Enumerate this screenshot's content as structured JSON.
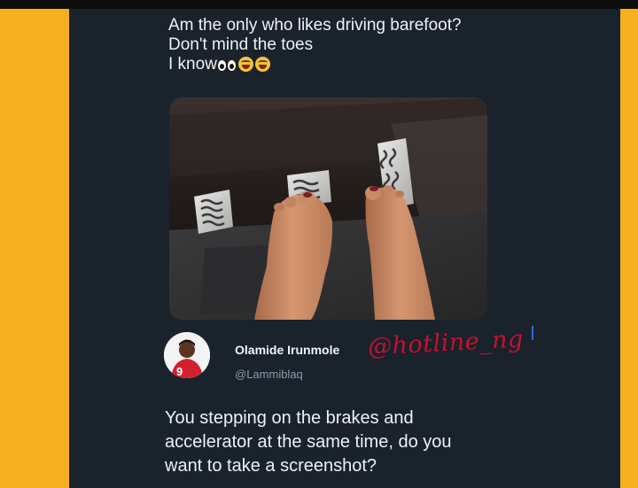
{
  "original_tweet": {
    "lines": [
      "Am the only who likes driving barefoot?",
      "Don't mind the toes",
      "I know"
    ],
    "emojis": [
      "eyes-icon",
      "laughing-face-icon",
      "laughing-face-icon"
    ]
  },
  "photo": {
    "subject": "bare feet on car pedals",
    "image_name": "feet-on-pedals-photo"
  },
  "reply": {
    "display_name": "Olamide Irunmole",
    "handle": "@Lammiblaq",
    "avatar_jersey_number": "9",
    "lines": [
      "You stepping on the brakes and",
      "accelerator at the same time, do you",
      "want to take a screenshot?"
    ]
  },
  "watermark": {
    "text": "@hotline_ng"
  },
  "colors": {
    "background": "#f7b21f",
    "card": "#1a222c",
    "watermark": "#c8102e",
    "handle": "#8d99a6"
  }
}
